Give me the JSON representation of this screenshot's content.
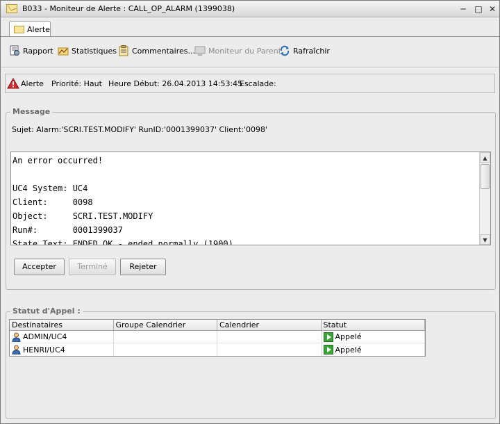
{
  "window": {
    "title": "B033 - Moniteur de Alerte : CALL_OP_ALARM (1399038)",
    "min": "─",
    "max": "□",
    "close": "✕"
  },
  "tab": {
    "label": "Alerte",
    "icon": "envelope-icon"
  },
  "toolbar": {
    "rapport": "Rapport",
    "statistiques": "Statistiques",
    "commentaires": "Commentaires...",
    "moniteur_parent": "Moniteur du Parent",
    "rafraichir": "Rafraîchir"
  },
  "info": {
    "alerte": "Alerte",
    "priorite": "Priorité: Haut",
    "heure_debut": "Heure Début: 26.04.2013 14:53:45",
    "escalade": "Escalade:"
  },
  "message": {
    "group_title": "Message",
    "subject": "Sujet:  Alarm:'SCRI.TEST.MODIFY' RunID:'0001399037' Client:'0098'",
    "body": "An error occurred!\n\nUC4 System: UC4\nClient:     0098\nObject:     SCRI.TEST.MODIFY\nRun#:       0001399037\nState Text: ENDED_OK - ended normally (1900)",
    "buttons": {
      "accepter": "Accepter",
      "termine": "Terminé",
      "rejeter": "Rejeter"
    }
  },
  "statut": {
    "group_title": "Statut d'Appel :",
    "columns": [
      "Destinataires",
      "Groupe Calendrier",
      "Calendrier",
      "Statut"
    ],
    "rows": [
      {
        "destinataire": "ADMIN/UC4",
        "groupe": "",
        "calendrier": "",
        "statut": "Appelé"
      },
      {
        "destinataire": "HENRI/UC4",
        "groupe": "",
        "calendrier": "",
        "statut": "Appelé"
      }
    ]
  }
}
